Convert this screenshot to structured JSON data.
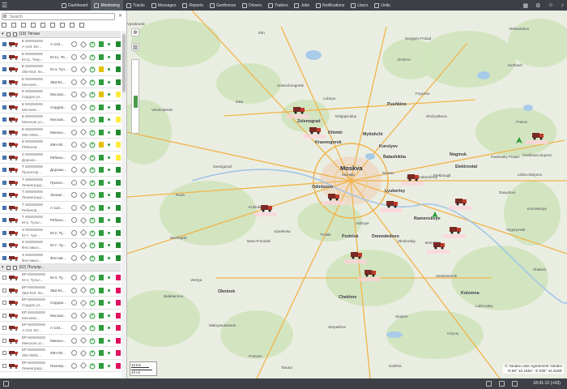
{
  "nav": {
    "items": [
      {
        "label": "Dashboard",
        "active": false
      },
      {
        "label": "Monitoring",
        "active": true
      },
      {
        "label": "Tracks",
        "active": false
      },
      {
        "label": "Messages",
        "active": false
      },
      {
        "label": "Reports",
        "active": false
      },
      {
        "label": "Geofences",
        "active": false
      },
      {
        "label": "Drivers",
        "active": false
      },
      {
        "label": "Trailers",
        "active": false
      },
      {
        "label": "Jobs",
        "active": false
      },
      {
        "label": "Notifications",
        "active": false
      },
      {
        "label": "Users",
        "active": false
      },
      {
        "label": "Units",
        "active": false
      }
    ]
  },
  "sidebar": {
    "search_placeholder": "Search",
    "groups": [
      {
        "label": "(18) Тягачи"
      },
      {
        "label": "(62) Полупр..."
      }
    ],
    "units": [
      {
        "id1": "E",
        "id2": "A-134. Вл...",
        "addr": "A-134...",
        "bar": "#2e9c3c",
        "dot": "#2a9c3a",
        "sq": "#1f8a2f",
        "checked": true
      },
      {
        "id1": "E",
        "id2": "М-11, Твер...",
        "addr": "M-11, Тв...",
        "bar": "#2e9c3c",
        "dot": "#2a9c3a",
        "sq": "#1f8a2f",
        "checked": true
      },
      {
        "id1": "E",
        "id2": "Зби-916. Кн...",
        "addr": "M-4, Тул...",
        "bar": "#e2c100",
        "dot": "#2a9c3a",
        "sq": "#1f8a2f",
        "checked": true
      },
      {
        "id1": "E",
        "id2": "Московс...",
        "addr": "3Би-91...",
        "bar": "#2e9c3c",
        "dot": "#2a9c3a",
        "sq": "#1f8a2f",
        "checked": true
      },
      {
        "id1": "E",
        "id2": "Сердов ул...",
        "addr": "Москов...",
        "bar": "#e2c100",
        "dot": "#2a9c3a",
        "sq": "#ffeb3b",
        "checked": true
      },
      {
        "id1": "E",
        "id2": "Московс...",
        "addr": "Сердов...",
        "bar": "#2e9c3c",
        "dot": "#2a9c3a",
        "sq": "#1f8a2f",
        "checked": true
      },
      {
        "id1": "E",
        "id2": "Минская ул...",
        "addr": "Москов...",
        "bar": "#2e9c3c",
        "dot": "#2a9c3a",
        "sq": "#ffeb3b",
        "checked": true
      },
      {
        "id1": "E",
        "id2": "49Н-0081...",
        "addr": "Минско...",
        "bar": "#2e9c3c",
        "dot": "#2a9c3a",
        "sq": "#1f8a2f",
        "checked": true
      },
      {
        "id1": "E",
        "id2": "Рябинов...",
        "addr": "49Н-00...",
        "bar": "#e2c100",
        "dot": "#2a9c3a",
        "sq": "#ffeb3b",
        "checked": true
      },
      {
        "id1": "C",
        "id2": "Дорожн...",
        "addr": "Рябино...",
        "bar": "#2e9c3c",
        "dot": "#2a9c3a",
        "sq": "#ffeb3b",
        "checked": true
      },
      {
        "id1": "T",
        "id2": "Проектир...",
        "addr": "Дорожн...",
        "bar": "#2e9c3c",
        "dot": "#2a9c3a",
        "sq": "#1f8a2f",
        "checked": true
      },
      {
        "id1": "T",
        "id2": "Ленинградс...",
        "addr": "Проект...",
        "bar": "#2e9c3c",
        "dot": "#2a9c3a",
        "sq": "#1f8a2f",
        "checked": true
      },
      {
        "id1": "T",
        "id2": "Ленинградс...",
        "addr": "Ленинг...",
        "bar": "#2e9c3c",
        "dot": "#2a9c3a",
        "sq": "#1f8a2f",
        "checked": true
      },
      {
        "id1": "T",
        "id2": "Рябинов...",
        "addr": "A-113...",
        "bar": "#2e9c3c",
        "dot": "#2a9c3a",
        "sq": "#1f8a2f",
        "checked": true
      },
      {
        "id1": "T",
        "id2": "M-2, Тульс...",
        "addr": "Рябино...",
        "bar": "#2e9c3c",
        "dot": "#2a9c3a",
        "sq": "#1f8a2f",
        "checked": true
      },
      {
        "id1": "X",
        "id2": "М-7, Чуп...",
        "addr": "M-2, Ту...",
        "bar": "#2e9c3c",
        "dot": "#2a9c3a",
        "sq": "#1f8a2f",
        "checked": true
      },
      {
        "id1": "X",
        "id2": "Фестивал...",
        "addr": "M-7, Чу...",
        "bar": "#2e9c3c",
        "dot": "#2a9c3a",
        "sq": "#1f8a2f",
        "checked": true
      },
      {
        "id1": "X",
        "id2": "Фестивал...",
        "addr": "Фестив...",
        "bar": "#2e9c3c",
        "dot": "#2a9c3a",
        "sq": "#1f8a2f",
        "checked": true
      }
    ],
    "trailers": [
      {
        "id1": "EP",
        "id2": "М-4, Тульс...",
        "addr": "M-4, Ту...",
        "bar": "#2e9c3c",
        "dot": "#2a9c3a",
        "sq": "#e0115f",
        "checked": false
      },
      {
        "id1": "EP",
        "id2": "3Би-916. Кн...",
        "addr": "3Би-91...",
        "bar": "#2e9c3c",
        "dot": "#2a9c3a",
        "sq": "#e0115f",
        "checked": false
      },
      {
        "id1": "EP",
        "id2": "Сердов ул...",
        "addr": "Сердов...",
        "bar": "#2e9c3c",
        "dot": "#2a9c3a",
        "sq": "#e0115f",
        "checked": false
      },
      {
        "id1": "EP",
        "id2": "Московс...",
        "addr": "Москов...",
        "bar": "#2e9c3c",
        "dot": "#2a9c3a",
        "sq": "#e0115f",
        "checked": false
      },
      {
        "id1": "EP",
        "id2": "A-134. Вл...",
        "addr": "A-134...",
        "bar": "#2e9c3c",
        "dot": "#2a9c3a",
        "sq": "#e0115f",
        "checked": false
      },
      {
        "id1": "EP",
        "id2": "Минская ул...",
        "addr": "Минско...",
        "bar": "#2e9c3c",
        "dot": "#2a9c3a",
        "sq": "#e0115f",
        "checked": false
      },
      {
        "id1": "EP",
        "id2": "49Н-0081...",
        "addr": "49Н-00...",
        "bar": "#2e9c3c",
        "dot": "#2a9c3a",
        "sq": "#e0115f",
        "checked": false
      },
      {
        "id1": "EP",
        "id2": "Ленинградс...",
        "addr": "Пионер...",
        "bar": "#2e9c3c",
        "dot": "#2a9c3a",
        "sq": "#e0115f",
        "checked": false
      }
    ]
  },
  "map": {
    "labels": [
      {
        "t": "Moskva",
        "c": "big"
      },
      {
        "t": "Москва",
        "c": ""
      },
      {
        "t": "Khimki",
        "c": "mid"
      },
      {
        "t": "Zelenograd",
        "c": "mid"
      },
      {
        "t": "Mytishchi",
        "c": "mid"
      },
      {
        "t": "Korolyov",
        "c": "mid"
      },
      {
        "t": "Balashikha",
        "c": "mid"
      },
      {
        "t": "Krasnogorsk",
        "c": "mid"
      },
      {
        "t": "Odintsovo",
        "c": "mid"
      },
      {
        "t": "Lyubertsy",
        "c": "mid"
      },
      {
        "t": "Reutov",
        "c": ""
      },
      {
        "t": "Zheleznodorozhny",
        "c": ""
      },
      {
        "t": "Noginsk",
        "c": "mid"
      },
      {
        "t": "Elektrostal",
        "c": "mid"
      },
      {
        "t": "Elektrougli",
        "c": ""
      },
      {
        "t": "Podolsk",
        "c": "mid"
      },
      {
        "t": "Domodedovo",
        "c": "mid"
      },
      {
        "t": "Vidnoye",
        "c": ""
      },
      {
        "t": "Ramenskoye",
        "c": "mid"
      },
      {
        "t": "Bronnitsy",
        "c": ""
      },
      {
        "t": "Zhukovsky",
        "c": ""
      },
      {
        "t": "Pushkino",
        "c": "mid"
      },
      {
        "t": "Fryazino",
        "c": ""
      },
      {
        "t": "Shchyolkovo",
        "c": ""
      },
      {
        "t": "Dolgoprudny",
        "c": ""
      },
      {
        "t": "Lobnya",
        "c": ""
      },
      {
        "t": "Solnechnogorsk",
        "c": ""
      },
      {
        "t": "Istra",
        "c": ""
      },
      {
        "t": "Zvenigorod",
        "c": ""
      },
      {
        "t": "Kubinka",
        "c": ""
      },
      {
        "t": "Naro-Fominsk",
        "c": ""
      },
      {
        "t": "Aprelevka",
        "c": ""
      },
      {
        "t": "Troitsk",
        "c": ""
      },
      {
        "t": "Chekhov",
        "c": "mid"
      },
      {
        "t": "Serpukhov",
        "c": ""
      },
      {
        "t": "Stupino",
        "c": ""
      },
      {
        "t": "Kolomna",
        "c": "mid"
      },
      {
        "t": "Voskresensk",
        "c": ""
      },
      {
        "t": "Orekhovo-Zuyevo",
        "c": ""
      },
      {
        "t": "Pavlovsky Posad",
        "c": ""
      },
      {
        "t": "Dmitrov",
        "c": ""
      },
      {
        "t": "Sergiyev Posad",
        "c": ""
      },
      {
        "t": "Vysokovsk",
        "c": ""
      },
      {
        "t": "Klin",
        "c": ""
      },
      {
        "t": "Volokolamsk",
        "c": ""
      },
      {
        "t": "Ruza",
        "c": ""
      },
      {
        "t": "Mozhaysk",
        "c": ""
      },
      {
        "t": "Vereya",
        "c": ""
      },
      {
        "t": "Balabanovo",
        "c": ""
      },
      {
        "t": "Obninsk",
        "c": "mid"
      },
      {
        "t": "Maloyaroslavets",
        "c": ""
      },
      {
        "t": "Tarusa",
        "c": ""
      },
      {
        "t": "Protvino",
        "c": ""
      },
      {
        "t": "Aleksandrov",
        "c": ""
      },
      {
        "t": "Kirzhach",
        "c": ""
      },
      {
        "t": "Pokrov",
        "c": ""
      },
      {
        "t": "Yegoryevsk",
        "c": ""
      },
      {
        "t": "Shatura",
        "c": ""
      },
      {
        "t": "Kurovskoye",
        "c": ""
      },
      {
        "t": "Likino-Dulyovo",
        "c": ""
      },
      {
        "t": "Davydovo",
        "c": ""
      },
      {
        "t": "Ozyory",
        "c": ""
      },
      {
        "t": "Kashira",
        "c": ""
      },
      {
        "t": "Lukhovitsy",
        "c": ""
      }
    ],
    "scale_km": "10 km",
    "scale_mi": "10 mi",
    "coords": "N 56° 10.1653' : E 035° 44.3188'",
    "copyright": "© Yandex  User Agreement  Yandex"
  },
  "footer": {
    "time": "18:41:12 (+03)"
  },
  "colors": {
    "topbar": "#3d4147",
    "accent": "#4a7bb7",
    "tag": "#d24a6a"
  }
}
